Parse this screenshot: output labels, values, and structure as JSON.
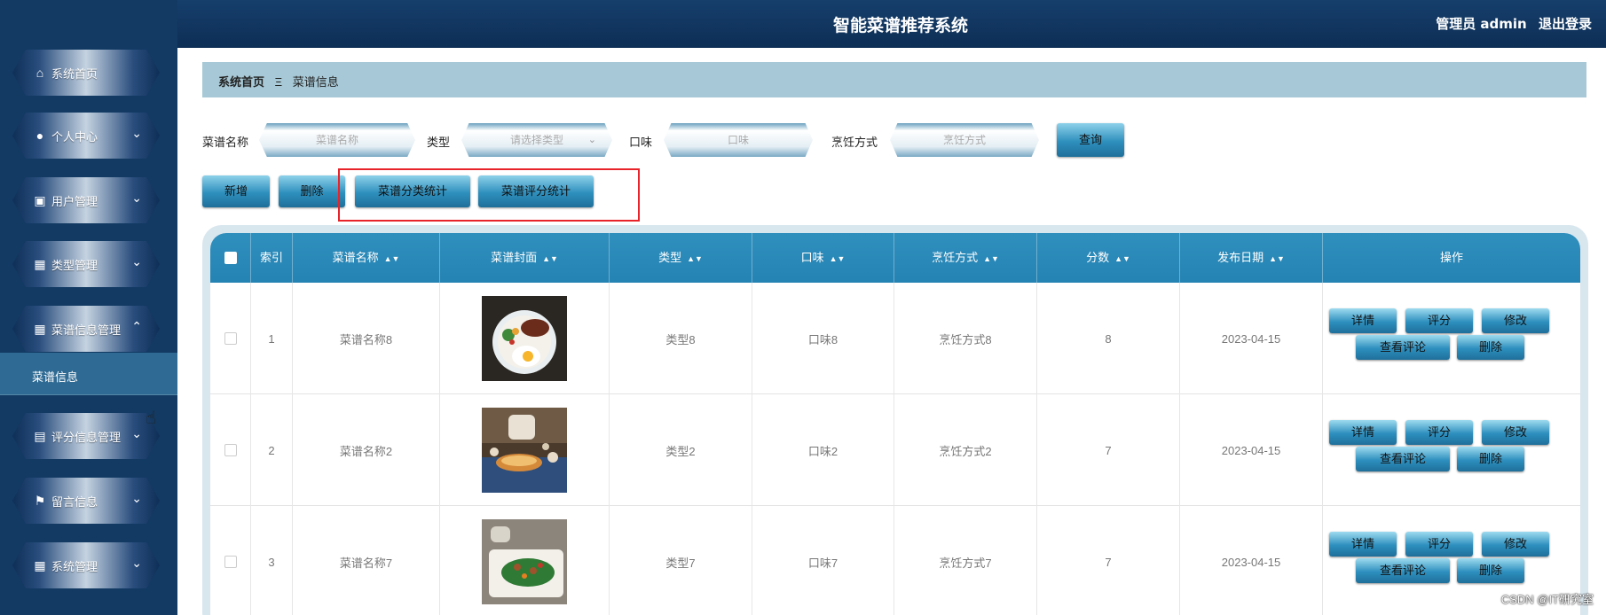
{
  "header": {
    "title": "智能菜谱推荐系统",
    "role": "管理员 admin",
    "logout": "退出登录"
  },
  "sidebar": {
    "items": [
      {
        "label": "系统首页",
        "icon": "home-icon",
        "expandable": false
      },
      {
        "label": "个人中心",
        "icon": "user-icon",
        "expandable": true
      },
      {
        "label": "用户管理",
        "icon": "clipboard-icon",
        "expandable": true
      },
      {
        "label": "类型管理",
        "icon": "grid-icon",
        "expandable": true
      },
      {
        "label": "菜谱信息管理",
        "icon": "grid-icon",
        "expandable": true,
        "expanded": true
      },
      {
        "label": "评分信息管理",
        "icon": "chat-icon",
        "expandable": true
      },
      {
        "label": "留言信息",
        "icon": "flag-icon",
        "expandable": true
      },
      {
        "label": "系统管理",
        "icon": "grid-icon",
        "expandable": true
      }
    ],
    "submenu": "菜谱信息"
  },
  "breadcrumb": {
    "home": "系统首页",
    "separator": "Ξ",
    "current": "菜谱信息"
  },
  "search": {
    "name_label": "菜谱名称",
    "name_placeholder": "菜谱名称",
    "type_label": "类型",
    "type_placeholder": "请选择类型",
    "taste_label": "口味",
    "taste_placeholder": "口味",
    "method_label": "烹饪方式",
    "method_placeholder": "烹饪方式",
    "query": "查询"
  },
  "actions": {
    "add": "新增",
    "delete": "删除",
    "category_stats": "菜谱分类统计",
    "rating_stats": "菜谱评分统计"
  },
  "table": {
    "headers": [
      "",
      "索引",
      "菜谱名称",
      "菜谱封面",
      "类型",
      "口味",
      "烹饪方式",
      "分数",
      "发布日期",
      "操作"
    ],
    "rows": [
      {
        "index": "1",
        "name": "菜谱名称8",
        "type": "类型8",
        "taste": "口味8",
        "method": "烹饪方式8",
        "score": "8",
        "date": "2023-04-15",
        "cover": "rice-bowl-with-egg"
      },
      {
        "index": "2",
        "name": "菜谱名称2",
        "type": "类型2",
        "taste": "口味2",
        "method": "烹饪方式2",
        "score": "7",
        "date": "2023-04-15",
        "cover": "table-spread-with-teapot"
      },
      {
        "index": "3",
        "name": "菜谱名称7",
        "type": "类型7",
        "taste": "口味7",
        "method": "烹饪方式7",
        "score": "7",
        "date": "2023-04-15",
        "cover": "green-vegetable-stir-fry"
      }
    ],
    "ops": {
      "detail": "详情",
      "rate": "评分",
      "edit": "修改",
      "comments": "查看评论",
      "delete": "删除"
    }
  },
  "watermark": "CSDN @IT研究室",
  "colors": {
    "header": "#0d2e55",
    "sidebar": "#123a63",
    "accent": "#2583b3",
    "highlight": "#e8232a"
  }
}
